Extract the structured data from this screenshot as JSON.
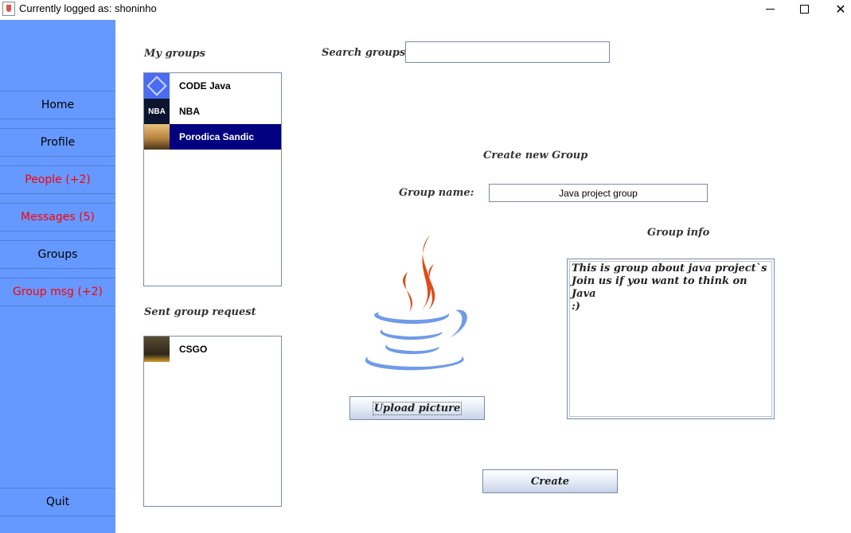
{
  "window": {
    "title": "Currently logged as: shoninho",
    "minimize_glyph": "",
    "close_glyph": "✕"
  },
  "sidebar": {
    "bg_color": "#6699ff",
    "items": [
      {
        "label": "Home",
        "color": "black"
      },
      {
        "label": "Profile",
        "color": "black"
      },
      {
        "label": "People (+2)",
        "color": "red"
      },
      {
        "label": "Messages (5)",
        "color": "red"
      },
      {
        "label": "Groups",
        "color": "black"
      },
      {
        "label": "Group msg (+2)",
        "color": "red"
      }
    ],
    "quit_label": "Quit"
  },
  "my_groups": {
    "label": "My groups",
    "items": [
      {
        "name": "CODE Java",
        "icon": "code-java-logo-icon",
        "selected": false
      },
      {
        "name": "NBA",
        "icon": "nba-logo-icon",
        "thumb_text": "NBA",
        "selected": false
      },
      {
        "name": "Porodica Sandic",
        "icon": "family-photo-icon",
        "selected": true
      }
    ]
  },
  "sent_requests": {
    "label": "Sent group request",
    "items": [
      {
        "name": "CSGO",
        "icon": "csgo-logo-icon"
      }
    ]
  },
  "search": {
    "label": "Search groups:",
    "value": ""
  },
  "create_group": {
    "heading": "Create new Group",
    "name_label": "Group name:",
    "name_value": "Java project group",
    "info_label": "Group info",
    "info_value": "This is group about java project`s\nJoin us if you want to think on Java\n:)",
    "upload_label": "Upload picture",
    "create_label": "Create",
    "picture_icon": "java-logo-icon"
  },
  "colors": {
    "selection": "#000080",
    "red_text": "#ff0000",
    "java_red": "#e04a1a",
    "java_blue": "#6f9be8"
  }
}
